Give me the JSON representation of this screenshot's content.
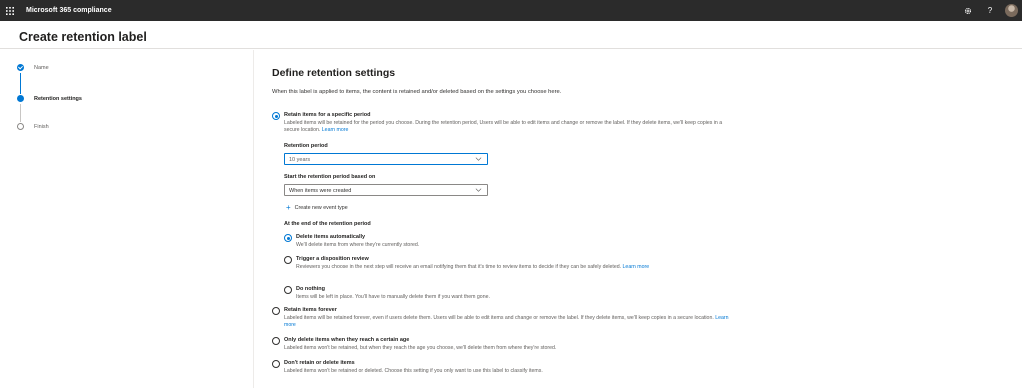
{
  "header": {
    "app_name": "Microsoft 365 compliance",
    "icons": [
      "waffle-icon",
      "gear-icon",
      "help-icon",
      "avatar"
    ],
    "help_glyph": "?"
  },
  "page": {
    "title": "Create retention label"
  },
  "steps": [
    {
      "label": "Name",
      "state": "completed"
    },
    {
      "label": "Retention settings",
      "state": "current"
    },
    {
      "label": "Finish",
      "state": "not-started"
    }
  ],
  "main": {
    "heading": "Define retention settings",
    "intro": "When this label is applied to items, the content is retained and/or deleted based on the settings you choose here.",
    "retain_specific": {
      "title": "Retain items for a specific period",
      "desc": "Labeled items will be retained for the period you choose. During the retention period, Users will be able to edit items and change or remove the label. If they delete items, we'll keep copies in a secure location.",
      "link": "Learn more",
      "selected": true
    },
    "retention_period": {
      "label": "Retention period",
      "value": "10 years"
    },
    "start_period": {
      "label": "Start the retention period based on",
      "value": "When items were created"
    },
    "create_event": "Create new event type",
    "end_of_period": {
      "label": "At the end of the retention period",
      "options": [
        {
          "title": "Delete items automatically",
          "desc": "We'll delete items from where they're currently stored.",
          "selected": true
        },
        {
          "title": "Trigger a disposition review",
          "desc": "Reviewers you choose in the next step will receive an email notifying them that it's time to review items to decide if they can be safely deleted.",
          "link": "Learn more",
          "selected": false
        },
        {
          "title": "Do nothing",
          "desc": "Items will be left in place. You'll have to manually delete them if you want them gone.",
          "selected": false
        }
      ]
    },
    "retain_forever": {
      "title": "Retain items forever",
      "desc": "Labeled items will be retained forever, even if users delete them. Users will be able to edit items and change or remove the label. If they delete items, we'll keep copies in a secure location.",
      "link": "Learn more",
      "selected": false
    },
    "only_delete": {
      "title": "Only delete items when they reach a certain age",
      "desc": "Labeled items won't be retained, but when they reach the age you choose, we'll delete them from where they're stored.",
      "selected": false
    },
    "dont_retain": {
      "title": "Don't retain or delete items",
      "desc": "Labeled items won't be retained or deleted. Choose this setting if you only want to use this label to classify items.",
      "selected": false
    }
  },
  "colors": {
    "accent": "#0078d4",
    "topbar": "#2b2b2b"
  }
}
